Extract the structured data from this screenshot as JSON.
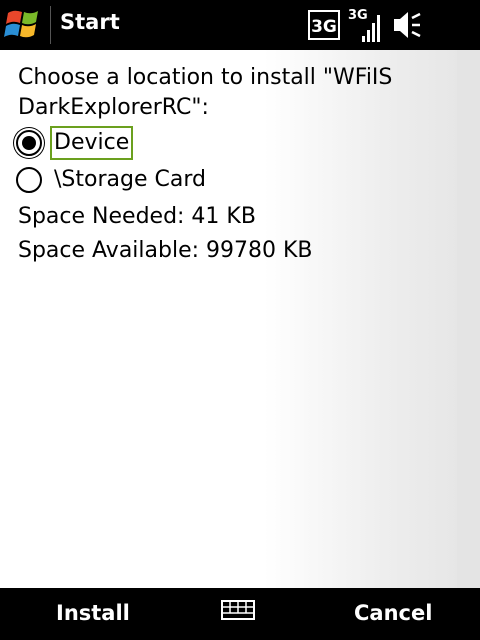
{
  "titlebar": {
    "title": "Start",
    "start_icon": "windows-flag-icon",
    "status_icons": [
      "3g-data-icon",
      "3g-signal-strength-icon",
      "volume-muted-icon"
    ],
    "network_label": "3G"
  },
  "installer": {
    "prompt": "Choose a location to install \"WFiIS DarkExplorerRC\":",
    "options": [
      {
        "label": "Device",
        "selected": true
      },
      {
        "label": "\\Storage Card",
        "selected": false
      }
    ],
    "space_needed": "Space Needed:  41 KB",
    "space_available": "Space Available: 99780 KB"
  },
  "softkeys": {
    "left": "Install",
    "center_icon": "keyboard-icon",
    "right": "Cancel"
  },
  "colors": {
    "bar_bg": "#000000",
    "focus_outline": "#6ba01e",
    "flag_red": "#e8472b",
    "flag_green": "#7ab929",
    "flag_blue": "#2a8fd6",
    "flag_yellow": "#f7b82a"
  }
}
